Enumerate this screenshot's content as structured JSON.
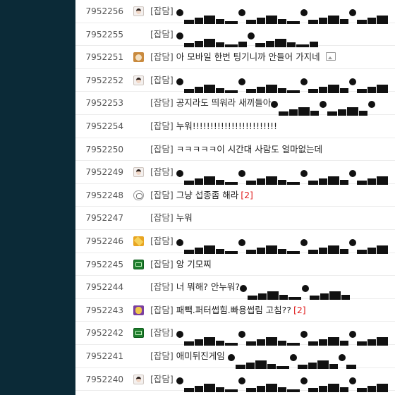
{
  "rows": [
    {
      "num": "7952256",
      "icon": "girl",
      "tag": "[잡담]",
      "text": "",
      "redact": "A",
      "count": ""
    },
    {
      "num": "7952255",
      "icon": "none",
      "tag": "[잡담]",
      "text": "",
      "redact": "B",
      "count": ""
    },
    {
      "num": "7952251",
      "icon": "dog",
      "tag": "[잡담]",
      "text": "아 모바일 한번 팅기니까 안들어 가지네",
      "redact": "",
      "count": "",
      "has_image": true
    },
    {
      "num": "7952252",
      "icon": "girl",
      "tag": "[잡담]",
      "text": "",
      "redact": "A",
      "count": ""
    },
    {
      "num": "7952253",
      "icon": "none",
      "tag": "[잡담]",
      "text": "공지라도 띄워라 새끼들아",
      "redact": "C",
      "count": ""
    },
    {
      "num": "7952254",
      "icon": "none",
      "tag": "[잡담]",
      "text": "누워!!!!!!!!!!!!!!!!!!!!!!!!",
      "redact": "",
      "count": ""
    },
    {
      "num": "7952250",
      "icon": "none",
      "tag": "[잡담]",
      "text": "ㅋㅋㅋㅋㅋ이 시간대 사람도 얼마없는데",
      "redact": "",
      "count": ""
    },
    {
      "num": "7952249",
      "icon": "girl",
      "tag": "[잡담]",
      "text": "",
      "redact": "A",
      "count": ""
    },
    {
      "num": "7952248",
      "icon": "owl",
      "tag": "[잡담]",
      "text": "그냥 섭종좀 해라",
      "redact": "",
      "count": "[2]"
    },
    {
      "num": "7952247",
      "icon": "none",
      "tag": "[잡담]",
      "text": "누워",
      "redact": "",
      "count": ""
    },
    {
      "num": "7952246",
      "icon": "gold",
      "tag": "[잡담]",
      "text": "",
      "redact": "A",
      "count": ""
    },
    {
      "num": "7952245",
      "icon": "green",
      "tag": "[잡담]",
      "text": "앙 기모찌",
      "redact": "",
      "count": ""
    },
    {
      "num": "7952244",
      "icon": "none",
      "tag": "[잡담]",
      "text": "너 뭐해? 안누워?",
      "redact": "D",
      "count": ""
    },
    {
      "num": "7952243",
      "icon": "purple",
      "tag": "[잡담]",
      "text": "패빽.퍼터썹힘.빠용썹림 고침??",
      "redact": "",
      "count": "[2]"
    },
    {
      "num": "7952242",
      "icon": "green",
      "tag": "[잡담]",
      "text": "",
      "redact": "A",
      "count": ""
    },
    {
      "num": "7952241",
      "icon": "none",
      "tag": "[잡담]",
      "text": "애미뒤진게임 ",
      "redact": "E",
      "count": ""
    },
    {
      "num": "7952240",
      "icon": "girl",
      "tag": "[잡담]",
      "text": "",
      "redact": "A",
      "count": ""
    }
  ]
}
